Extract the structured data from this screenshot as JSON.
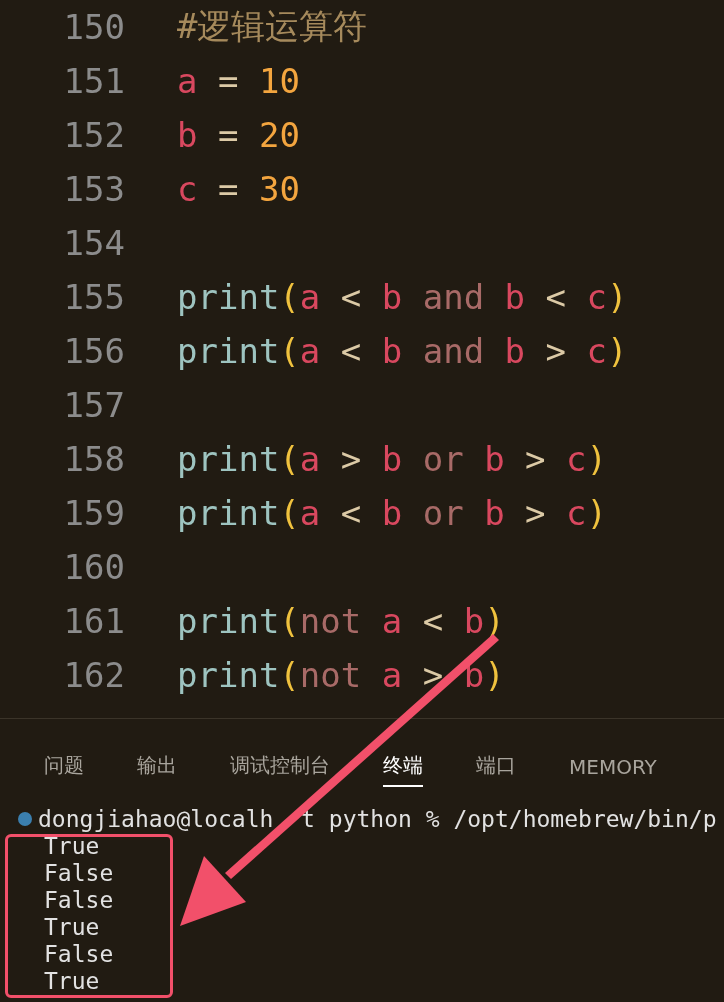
{
  "editor": {
    "lines": [
      {
        "number": "150",
        "tokens": [
          {
            "text": "#逻辑运算符",
            "kind": "comment"
          }
        ]
      },
      {
        "number": "151",
        "tokens": [
          {
            "text": "a",
            "kind": "variable"
          },
          {
            "text": " = ",
            "kind": "operator"
          },
          {
            "text": "10",
            "kind": "number"
          }
        ]
      },
      {
        "number": "152",
        "tokens": [
          {
            "text": "b",
            "kind": "variable"
          },
          {
            "text": " = ",
            "kind": "operator"
          },
          {
            "text": "20",
            "kind": "number"
          }
        ]
      },
      {
        "number": "153",
        "tokens": [
          {
            "text": "c",
            "kind": "variable"
          },
          {
            "text": " = ",
            "kind": "operator"
          },
          {
            "text": "30",
            "kind": "number"
          }
        ]
      },
      {
        "number": "154"
      },
      {
        "number": "155",
        "tokens": [
          {
            "text": "print",
            "kind": "function"
          },
          {
            "text": "(",
            "kind": "bracket"
          },
          {
            "text": "a",
            "kind": "variable"
          },
          {
            "text": " < ",
            "kind": "operator"
          },
          {
            "text": "b",
            "kind": "variable"
          },
          {
            "text": " and ",
            "kind": "keyword"
          },
          {
            "text": "b",
            "kind": "variable"
          },
          {
            "text": " < ",
            "kind": "operator"
          },
          {
            "text": "c",
            "kind": "variable"
          },
          {
            "text": ")",
            "kind": "bracket"
          }
        ]
      },
      {
        "number": "156",
        "tokens": [
          {
            "text": "print",
            "kind": "function"
          },
          {
            "text": "(",
            "kind": "bracket"
          },
          {
            "text": "a",
            "kind": "variable"
          },
          {
            "text": " < ",
            "kind": "operator"
          },
          {
            "text": "b",
            "kind": "variable"
          },
          {
            "text": " and ",
            "kind": "keyword"
          },
          {
            "text": "b",
            "kind": "variable"
          },
          {
            "text": " > ",
            "kind": "operator"
          },
          {
            "text": "c",
            "kind": "variable"
          },
          {
            "text": ")",
            "kind": "bracket"
          }
        ]
      },
      {
        "number": "157"
      },
      {
        "number": "158",
        "tokens": [
          {
            "text": "print",
            "kind": "function"
          },
          {
            "text": "(",
            "kind": "bracket"
          },
          {
            "text": "a",
            "kind": "variable"
          },
          {
            "text": " > ",
            "kind": "operator"
          },
          {
            "text": "b",
            "kind": "variable"
          },
          {
            "text": " or ",
            "kind": "keyword"
          },
          {
            "text": "b",
            "kind": "variable"
          },
          {
            "text": " > ",
            "kind": "operator"
          },
          {
            "text": "c",
            "kind": "variable"
          },
          {
            "text": ")",
            "kind": "bracket"
          }
        ]
      },
      {
        "number": "159",
        "tokens": [
          {
            "text": "print",
            "kind": "function"
          },
          {
            "text": "(",
            "kind": "bracket"
          },
          {
            "text": "a",
            "kind": "variable"
          },
          {
            "text": " < ",
            "kind": "operator"
          },
          {
            "text": "b",
            "kind": "variable"
          },
          {
            "text": " or ",
            "kind": "keyword"
          },
          {
            "text": "b",
            "kind": "variable"
          },
          {
            "text": " > ",
            "kind": "operator"
          },
          {
            "text": "c",
            "kind": "variable"
          },
          {
            "text": ")",
            "kind": "bracket"
          }
        ]
      },
      {
        "number": "160"
      },
      {
        "number": "161",
        "tokens": [
          {
            "text": "print",
            "kind": "function"
          },
          {
            "text": "(",
            "kind": "bracket"
          },
          {
            "text": "not ",
            "kind": "keyword"
          },
          {
            "text": "a",
            "kind": "variable"
          },
          {
            "text": " < ",
            "kind": "operator"
          },
          {
            "text": "b",
            "kind": "variable"
          },
          {
            "text": ")",
            "kind": "bracket"
          }
        ]
      },
      {
        "number": "162",
        "tokens": [
          {
            "text": "print",
            "kind": "function"
          },
          {
            "text": "(",
            "kind": "bracket"
          },
          {
            "text": "not ",
            "kind": "keyword"
          },
          {
            "text": "a",
            "kind": "variable"
          },
          {
            "text": " > ",
            "kind": "operator"
          },
          {
            "text": "b",
            "kind": "variable"
          },
          {
            "text": ")",
            "kind": "bracket"
          }
        ]
      }
    ]
  },
  "panel": {
    "tabs": [
      {
        "label": "问题",
        "selected": false
      },
      {
        "label": "输出",
        "selected": false
      },
      {
        "label": "调试控制台",
        "selected": false
      },
      {
        "label": "终端",
        "selected": true
      },
      {
        "label": "端口",
        "selected": false
      },
      {
        "label": "MEMORY",
        "selected": false
      }
    ],
    "terminal": {
      "prompt": [
        "dongjiahao@localh",
        "t python % /opt/homebrew/bin/p"
      ],
      "output": [
        "True",
        "False",
        "False",
        "True",
        "False",
        "True"
      ]
    }
  }
}
